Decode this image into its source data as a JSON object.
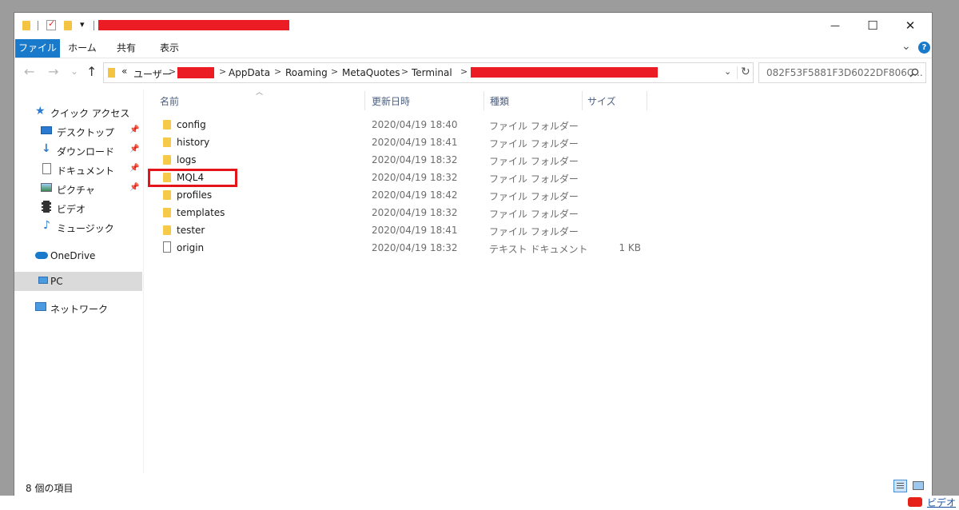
{
  "titlebar": {
    "quick_access_dropdown": "▾",
    "minimize": "—",
    "maximize": "☐",
    "close": "✕"
  },
  "ribbon": {
    "tabs": [
      "ファイル",
      "ホーム",
      "共有",
      "表示"
    ],
    "expand": "⌄",
    "help": "?"
  },
  "nav": {
    "back": "←",
    "forward": "→",
    "recent": "⌄",
    "up": "↑",
    "overflow": "«",
    "breadcrumbs": [
      "ユーザー",
      "AppData",
      "Roaming",
      "MetaQuotes",
      "Terminal"
    ],
    "search_placeholder": "082F53F5881F3D6022DF806C..."
  },
  "sidebar": {
    "quick_access": "クイック アクセス",
    "items": [
      "デスクトップ",
      "ダウンロード",
      "ドキュメント",
      "ピクチャ",
      "ビデオ",
      "ミュージック"
    ],
    "onedrive": "OneDrive",
    "pc": "PC",
    "network": "ネットワーク"
  },
  "columns": [
    "名前",
    "更新日時",
    "種類",
    "サイズ"
  ],
  "files": [
    {
      "name": "config",
      "date": "2020/04/19 18:40",
      "type": "ファイル フォルダー",
      "size": ""
    },
    {
      "name": "history",
      "date": "2020/04/19 18:41",
      "type": "ファイル フォルダー",
      "size": ""
    },
    {
      "name": "logs",
      "date": "2020/04/19 18:32",
      "type": "ファイル フォルダー",
      "size": ""
    },
    {
      "name": "MQL4",
      "date": "2020/04/19 18:32",
      "type": "ファイル フォルダー",
      "size": ""
    },
    {
      "name": "profiles",
      "date": "2020/04/19 18:42",
      "type": "ファイル フォルダー",
      "size": ""
    },
    {
      "name": "templates",
      "date": "2020/04/19 18:32",
      "type": "ファイル フォルダー",
      "size": ""
    },
    {
      "name": "tester",
      "date": "2020/04/19 18:41",
      "type": "ファイル フォルダー",
      "size": ""
    },
    {
      "name": "origin",
      "date": "2020/04/19 18:32",
      "type": "テキスト ドキュメント",
      "size": "1 KB"
    }
  ],
  "status": {
    "item_count": "8 個の項目"
  },
  "background": {
    "corner_label": "ビデオ"
  },
  "colors": {
    "accent": "#1979ca",
    "redaction": "#ec1c24",
    "highlight_box": "#e3151a",
    "folder": "#f7c948"
  }
}
